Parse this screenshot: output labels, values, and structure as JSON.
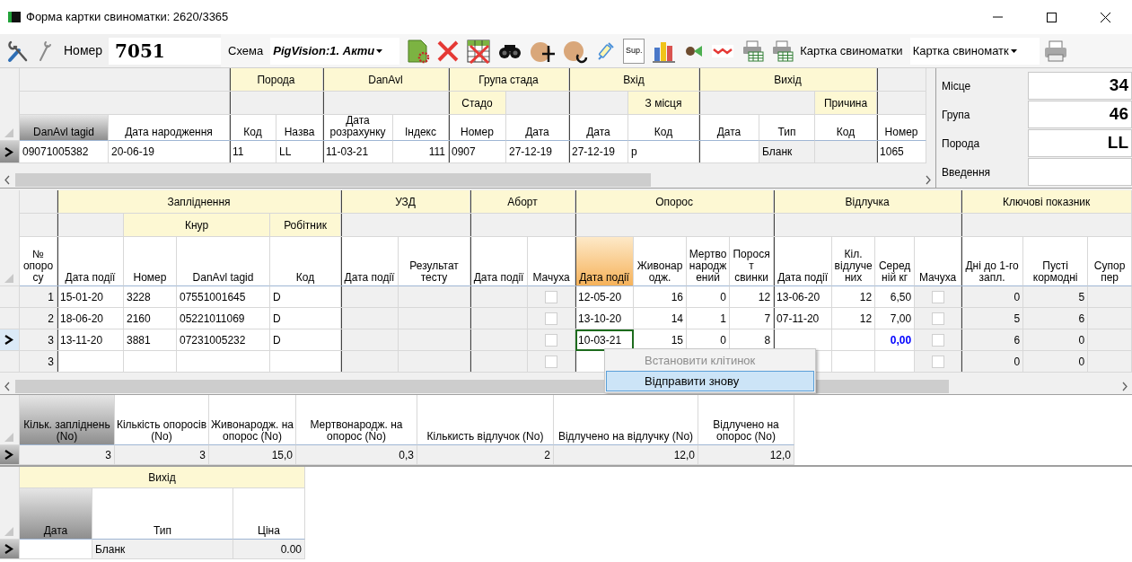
{
  "window": {
    "title": "Форма картки свиноматки: 2620/3365"
  },
  "toolbar": {
    "number_label": "Номер",
    "number": "7051",
    "scheme_label": "Схема",
    "scheme": "PigVision:1. Акти",
    "sup_label": "Sup.",
    "report_label": "Картка свиноматки",
    "report": "Картка свиноматк"
  },
  "top_grid": {
    "focused": false,
    "groups": [
      {
        "subgroups": [
          {
            "columns": [
              {
                "label": "DanAvl tagid",
                "kind": "text",
                "readonly": false,
                "selected": true
              },
              {
                "label": "Дата народження",
                "kind": "text",
                "readonly": false,
                "selected": false
              }
            ]
          }
        ]
      },
      {
        "label": "Порода",
        "subgroups": [
          {
            "columns": [
              {
                "label": "Код",
                "kind": "text",
                "readonly": false,
                "selected": false
              },
              {
                "label": "Назва",
                "kind": "text",
                "readonly": false,
                "selected": false
              }
            ]
          }
        ]
      },
      {
        "label": "DanAvl",
        "subgroups": [
          {
            "columns": [
              {
                "label": "Дата розрахунку",
                "kind": "text",
                "readonly": false,
                "selected": false
              },
              {
                "label": "Індекс",
                "kind": "number",
                "readonly": false,
                "selected": false
              }
            ]
          }
        ]
      },
      {
        "label": "Група стада",
        "subgroups": [
          {
            "label": "Стадо",
            "columns": [
              {
                "label": "Номер",
                "kind": "text",
                "readonly": false,
                "selected": false
              }
            ]
          },
          {
            "columns": [
              {
                "label": "Дата",
                "kind": "text",
                "readonly": false,
                "selected": false
              }
            ]
          }
        ]
      },
      {
        "label": "Вхід",
        "subgroups": [
          {
            "columns": [
              {
                "label": "Дата",
                "kind": "text",
                "readonly": false,
                "selected": false
              }
            ]
          },
          {
            "label": "З місця",
            "columns": [
              {
                "label": "Код",
                "kind": "text",
                "readonly": false,
                "selected": false
              }
            ]
          }
        ]
      },
      {
        "label": "Вихід",
        "subgroups": [
          {
            "columns": [
              {
                "label": "Дата",
                "kind": "text",
                "readonly": false,
                "selected": false
              },
              {
                "label": "Тип",
                "kind": "text",
                "readonly": true,
                "selected": false
              }
            ]
          },
          {
            "label": "Причина",
            "columns": [
              {
                "label": "Код",
                "kind": "text",
                "readonly": true,
                "selected": false
              }
            ]
          }
        ]
      },
      {
        "subgroups": [
          {
            "columns": [
              {
                "label": "Номер",
                "kind": "text",
                "readonly": false,
                "selected": false
              }
            ]
          }
        ]
      }
    ],
    "rows": [
      {
        "current": true,
        "cells": [
          "09071005382",
          "20-06-19",
          "11",
          "LL",
          "11-03-21",
          "111",
          "0907",
          "27-12-19",
          "27-12-19",
          "р",
          null,
          "Бланк",
          null,
          "1065"
        ]
      }
    ]
  },
  "info_panel": {
    "fields": [
      {
        "label": "Місце",
        "value": "34"
      },
      {
        "label": "Група",
        "value": "46"
      },
      {
        "label": "Порода",
        "value": "LL"
      },
      {
        "label": "Введення"
      }
    ]
  },
  "farrowing_grid": {
    "focused": true,
    "groups": [
      {
        "subgroups": [
          {
            "columns": [
              {
                "label": "№ опоросу",
                "kind": "number",
                "readonly": true,
                "selected": false
              }
            ]
          }
        ]
      },
      {
        "label": "Запліднення",
        "subgroups": [
          {
            "columns": [
              {
                "label": "Дата події",
                "kind": "text",
                "readonly": false,
                "selected": false
              }
            ]
          },
          {
            "label": "Кнур",
            "columns": [
              {
                "label": "Номер",
                "kind": "text",
                "readonly": false,
                "selected": false
              },
              {
                "label": "DanAvl tagid",
                "kind": "text",
                "readonly": false,
                "selected": false
              }
            ]
          },
          {
            "label": "Робітник",
            "columns": [
              {
                "label": "Код",
                "kind": "text",
                "readonly": false,
                "selected": false
              }
            ]
          }
        ]
      },
      {
        "label": "УЗД",
        "subgroups": [
          {
            "columns": [
              {
                "label": "Дата події",
                "kind": "text",
                "readonly": true,
                "selected": false
              },
              {
                "label": "Результат тесту",
                "kind": "text",
                "readonly": true,
                "selected": false
              }
            ]
          }
        ]
      },
      {
        "label": "Аборт",
        "subgroups": [
          {
            "columns": [
              {
                "label": "Дата події",
                "kind": "text",
                "readonly": true,
                "selected": false
              },
              {
                "label": "Мачуха",
                "kind": "check",
                "readonly": true,
                "selected": false
              }
            ]
          }
        ]
      },
      {
        "label": "Опорос",
        "subgroups": [
          {
            "columns": [
              {
                "label": "Дата події",
                "kind": "text",
                "readonly": false,
                "selected": true
              },
              {
                "label": "Живонародж.",
                "kind": "number",
                "readonly": false,
                "selected": false
              },
              {
                "label": "Мертвонароджений",
                "kind": "number",
                "readonly": false,
                "selected": false
              },
              {
                "label": "Поросят свинки",
                "kind": "number",
                "readonly": false,
                "selected": false
              }
            ]
          }
        ]
      },
      {
        "label": "Відлучка",
        "subgroups": [
          {
            "columns": [
              {
                "label": "Дата події",
                "kind": "text",
                "readonly": false,
                "selected": false
              },
              {
                "label": "Кіл. відлучених",
                "kind": "number",
                "readonly": false,
                "selected": false
              },
              {
                "label": "Середній кг",
                "kind": "number",
                "readonly": false,
                "selected": false
              },
              {
                "label": "Мачуха",
                "kind": "check",
                "readonly": true,
                "selected": false
              }
            ]
          }
        ]
      },
      {
        "label": "Ключові показник",
        "subgroups": [
          {
            "columns": [
              {
                "label": "Дні до 1-го запл.",
                "kind": "number",
                "readonly": true,
                "selected": false
              },
              {
                "label": "Пусті кормодні",
                "kind": "number",
                "readonly": true,
                "selected": false
              },
              {
                "label": "Супор пер",
                "kind": "number",
                "readonly": true,
                "selected": false
              }
            ]
          }
        ]
      }
    ],
    "rows": [
      {
        "current": false,
        "cells": [
          "1",
          "15-01-20",
          "3228",
          "07551001645",
          "D",
          null,
          null,
          null,
          false,
          "12-05-20",
          "16",
          "0",
          "12",
          "13-06-20",
          "12",
          "6,50",
          false,
          "0",
          "5",
          null
        ]
      },
      {
        "current": false,
        "cells": [
          "2",
          "18-06-20",
          "2160",
          "05221011069",
          "D",
          null,
          null,
          null,
          false,
          "13-10-20",
          "14",
          "1",
          "7",
          "07-11-20",
          "12",
          "7,00",
          false,
          "5",
          "6",
          null
        ]
      },
      {
        "current": true,
        "cells": [
          "3",
          "13-11-20",
          "3881",
          "07231005232",
          "D",
          null,
          null,
          null,
          false,
          {
            "text": "10-03-21",
            "focused": true
          },
          "15",
          "0",
          "8",
          null,
          null,
          {
            "text": "0,00",
            "color": "#0000ff"
          },
          false,
          "6",
          "0",
          null
        ]
      },
      {
        "current": false,
        "cells": [
          "3",
          null,
          null,
          null,
          null,
          null,
          null,
          null,
          false,
          null,
          null,
          null,
          null,
          null,
          null,
          null,
          false,
          "0",
          "0",
          null
        ]
      }
    ]
  },
  "context_menu": {
    "items": [
      {
        "label": "Встановити клітинок",
        "disabled": true,
        "selected": false
      },
      {
        "label": "Відправити знову",
        "disabled": false,
        "selected": true
      }
    ]
  },
  "summary_grid": {
    "focused": false,
    "columns": [
      {
        "label": "Кільк. запліднень (No)",
        "kind": "number",
        "readonly": true,
        "selected": true
      },
      {
        "label": "Кількість опоросів (No)",
        "kind": "number",
        "readonly": true,
        "selected": false
      },
      {
        "label": "Живонародж. на опорос (No)",
        "kind": "number",
        "readonly": true,
        "selected": false
      },
      {
        "label": "Мертвонародж. на опорос (No)",
        "kind": "number",
        "readonly": true,
        "selected": false
      },
      {
        "label": "Кількисть відлучок (No)",
        "kind": "number",
        "readonly": true,
        "selected": false
      },
      {
        "label": "Відлучено на відлучку (No)",
        "kind": "number",
        "readonly": true,
        "selected": false
      },
      {
        "label": "Відлучено на опорос (No)",
        "kind": "number",
        "readonly": true,
        "selected": false
      }
    ],
    "rows": [
      {
        "current": true,
        "cells": [
          "3",
          "3",
          "15,0",
          "0,3",
          "2",
          "12,0",
          "12,0"
        ]
      }
    ]
  },
  "exit_grid": {
    "focused": false,
    "groups": [
      {
        "label": "Вихід",
        "columns": [
          {
            "label": "Дата",
            "kind": "text",
            "readonly": false,
            "selected": true
          },
          {
            "label": "Тип",
            "kind": "text",
            "readonly": true,
            "selected": false
          },
          {
            "label": "Ціна",
            "kind": "number",
            "readonly": true,
            "selected": false
          }
        ]
      }
    ],
    "rows": [
      {
        "current": true,
        "cells": [
          null,
          "Бланк",
          "0.00"
        ]
      }
    ]
  }
}
